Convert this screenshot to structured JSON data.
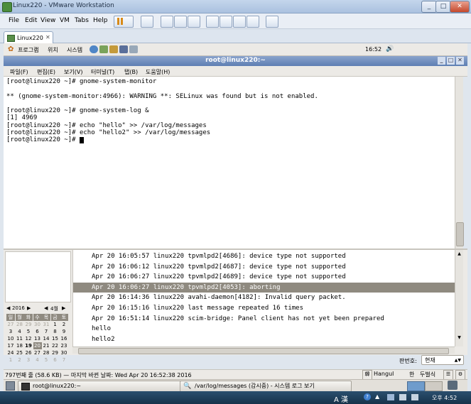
{
  "vmware": {
    "title": "Linux220 - VMware Workstation",
    "menu": [
      "File",
      "Edit",
      "View",
      "VM",
      "Tabs",
      "Help"
    ],
    "tab_label": "Linux220",
    "clock": "오후 4:52"
  },
  "gnome_panel": {
    "menus": [
      "프로그램",
      "위치",
      "시스템"
    ],
    "clock": "16:52"
  },
  "terminal": {
    "title": "root@linux220:~",
    "menu": [
      "파일(F)",
      "편집(E)",
      "보기(V)",
      "터미널(T)",
      "탭(B)",
      "도움말(H)"
    ],
    "lines": [
      "[root@linux220 ~]# gnome-system-monitor",
      "",
      "** (gnome-system-monitor:4966): WARNING **: SELinux was found but is not enabled.",
      "",
      "[root@linux220 ~]# gnome-system-log &",
      "[1] 4969",
      "[root@linux220 ~]# echo \"hello\" >> /var/log/messages",
      "[root@linux220 ~]# echo \"hello2\" >> /var/log/messages",
      "[root@linux220 ~]# "
    ]
  },
  "calendar": {
    "year": "2016",
    "month": "4월",
    "weekdays": [
      "일",
      "월",
      "화",
      "수",
      "목",
      "금",
      "토"
    ],
    "weeks": [
      [
        "27",
        "28",
        "29",
        "30",
        "31",
        "1",
        "2"
      ],
      [
        "3",
        "4",
        "5",
        "6",
        "7",
        "8",
        "9"
      ],
      [
        "10",
        "11",
        "12",
        "13",
        "14",
        "15",
        "16"
      ],
      [
        "17",
        "18",
        "19",
        "20",
        "21",
        "22",
        "23"
      ],
      [
        "24",
        "25",
        "26",
        "27",
        "28",
        "29",
        "30"
      ],
      [
        "1",
        "2",
        "3",
        "4",
        "5",
        "6",
        "7"
      ]
    ],
    "selected": "20"
  },
  "log": {
    "rows": [
      "Apr 20 16:05:57 linux220 tpvmlpd2[4686]: device type not supported",
      "Apr 20 16:06:12 linux220 tpvmlpd2[4687]: device type not supported",
      "Apr 20 16:06:27 linux220 tpvmlpd2[4689]: device type not supported",
      "Apr 20 16:06:27 linux220 tpvmlpd2[4053]: aborting",
      "Apr 20 16:14:36 linux220 avahi-daemon[4182]: Invalid query packet.",
      "Apr 20 16:15:16 linux220 last message repeated 16 times",
      "Apr 20 16:51:14 linux220 scim-bridge: Panel client has not yet been prepared",
      "hello",
      "hello2"
    ],
    "selected_index": 3,
    "filter_label": "판번호:",
    "filter_value": "현재"
  },
  "statusbar": {
    "text": "797번째 줄 (58.6 KB) — 마지막 바뀐 날짜: Wed Apr 20 16:52:38 2016",
    "ime": [
      "Hangul",
      "한",
      "두벌식"
    ]
  },
  "taskbar": {
    "items": [
      "root@linux220:~",
      "/var/log/messages (감시중) - 시스템 로그 보기"
    ]
  }
}
